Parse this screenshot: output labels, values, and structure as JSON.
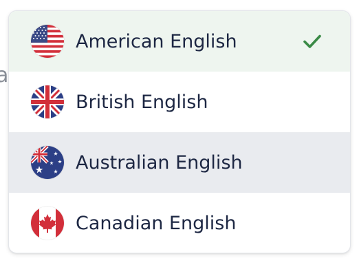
{
  "background": {
    "partial_text": "as"
  },
  "dropdown": {
    "selected_index": 0,
    "hovered_index": 2,
    "options": [
      {
        "label": "American English",
        "flag_icon": "us-flag-icon",
        "selected": true
      },
      {
        "label": "British English",
        "flag_icon": "uk-flag-icon",
        "selected": false
      },
      {
        "label": "Australian English",
        "flag_icon": "australia-flag-icon",
        "selected": false
      },
      {
        "label": "Canadian English",
        "flag_icon": "canada-flag-icon",
        "selected": false
      }
    ],
    "check_icon": "checkmark-icon"
  },
  "colors": {
    "selected_bg": "#eef5ef",
    "hover_bg": "#e9ebef",
    "text": "#1d2743",
    "check": "#3a8a46"
  }
}
